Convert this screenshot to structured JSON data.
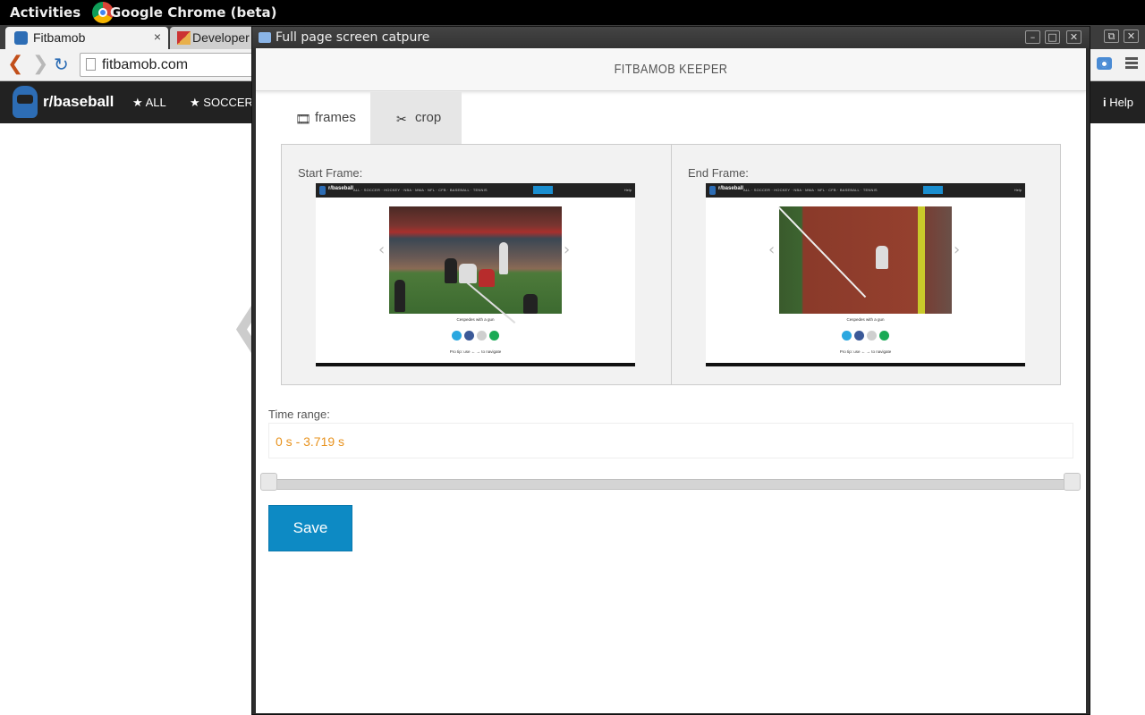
{
  "system": {
    "activities": "Activities",
    "app_name": "Google Chrome (beta)"
  },
  "browser": {
    "tabs": [
      {
        "label": "Fitbamob",
        "close": "×"
      },
      {
        "label": "Developer"
      }
    ],
    "url": "fitbamob.com"
  },
  "site": {
    "brand": "r/baseball",
    "nav": [
      {
        "label": "ALL"
      },
      {
        "label": "SOCCER"
      }
    ],
    "help": "Help"
  },
  "extension": {
    "window_title": "Full page screen catpure",
    "app_title": "FITBAMOB KEEPER",
    "tabs": [
      {
        "label": "frames",
        "icon": "film-icon"
      },
      {
        "label": "crop",
        "icon": "scissors-icon"
      }
    ],
    "start_label": "Start Frame:",
    "end_label": "End Frame:",
    "thumbnail": {
      "brand": "r/baseball",
      "nav": "ALL  ·  SOCCER  ·  HOCKEY  ·  NBA  ·  MMA  ·  NFL  ·  CFB  ·  BASEBALL  ·  TENNIS",
      "help": "Help",
      "caption": "Cespedes with a gun",
      "tip": "Pro tip: use ← → to navigate"
    },
    "time_label": "Time range:",
    "time_value": "0 s - 3.719 s",
    "range": {
      "start_fraction": 0.0,
      "end_fraction": 1.0
    },
    "save_label": "Save"
  },
  "colors": {
    "accent": "#0d8ac4",
    "time_text": "#e8931f",
    "share": [
      "#2aa7e0",
      "#3b5998",
      "#cfcfcf",
      "#1aaa55"
    ]
  }
}
